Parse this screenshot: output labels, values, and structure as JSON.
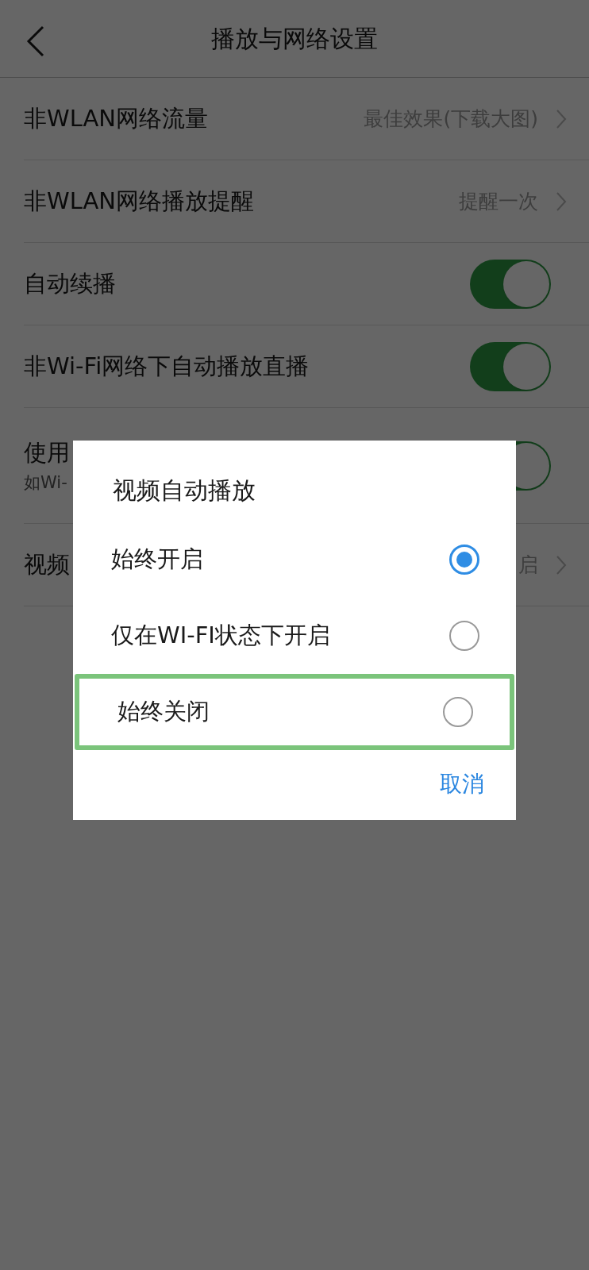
{
  "header": {
    "title": "播放与网络设置"
  },
  "settings": [
    {
      "kind": "link",
      "label": "非WLAN网络流量",
      "value": "最佳效果(下载大图)"
    },
    {
      "kind": "link",
      "label": "非WLAN网络播放提醒",
      "value": "提醒一次"
    },
    {
      "kind": "toggle",
      "label": "自动续播",
      "on": true
    },
    {
      "kind": "toggle",
      "label": "非Wi-Fi网络下自动播放直播",
      "on": true
    },
    {
      "kind": "toggle",
      "label": "使用",
      "subtitle": "如Wi-",
      "on": true
    },
    {
      "kind": "link",
      "label": "视频",
      "value": "启"
    }
  ],
  "dialog": {
    "title": "视频自动播放",
    "options": [
      {
        "label": "始终开启",
        "selected": true,
        "highlighted": false
      },
      {
        "label": "仅在WI-FI状态下开启",
        "selected": false,
        "highlighted": false
      },
      {
        "label": "始终关闭",
        "selected": false,
        "highlighted": true
      }
    ],
    "cancel": "取消"
  }
}
